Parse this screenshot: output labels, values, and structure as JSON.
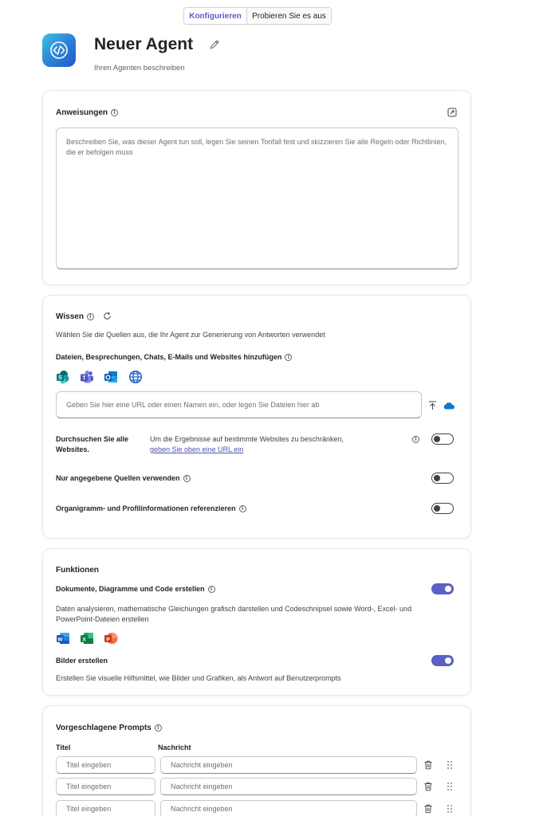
{
  "tabs": {
    "configure": "Konfigurieren",
    "try": "Probieren Sie es aus"
  },
  "agent": {
    "name": "Neuer Agent",
    "description": "Ihren Agenten beschreiben"
  },
  "instructions": {
    "title": "Anweisungen",
    "placeholder": "Beschreiben Sie, was dieser Agent tun soll, legen Sie seinen Tonfall fest und skizzieren Sie alle Regeln oder Richtlinien, die er befolgen muss"
  },
  "knowledge": {
    "title": "Wissen",
    "subtitle": "Wählen Sie die Quellen aus, die Ihr Agent zur Generierung von Antworten verwendet",
    "add_label": "Dateien, Besprechungen, Chats, E-Mails und Websites hinzufügen",
    "url_placeholder": "Geben Sie hier eine URL oder einen Namen ein, oder legen Sie Dateien hier ab",
    "search_all_label": "Durchsuchen Sie alle Websites.",
    "search_all_desc": "Um die Ergebnisse auf bestimmte Websites zu beschränken,",
    "search_all_link": "geben Sie oben eine URL ein",
    "only_sources_label": "Nur angegebene Quellen verwenden",
    "org_label": "Organigramm- und Profilinformationen referenzieren",
    "toggles": {
      "search_all": false,
      "only_sources": false,
      "org": false
    }
  },
  "functions": {
    "title": "Funktionen",
    "docs_label": "Dokumente, Diagramme und Code erstellen",
    "docs_desc": "Daten analysieren, mathematische Gleichungen grafisch darstellen und Codeschnipsel sowie Word-, Excel- und PowerPoint-Dateien erstellen",
    "images_label": "Bilder erstellen",
    "images_desc": "Erstellen Sie visuelle Hilfsmittel, wie Bilder und Grafiken, als Antwort auf Benutzerprompts",
    "toggles": {
      "docs": true,
      "images": true
    }
  },
  "prompts": {
    "title": "Vorgeschlagene Prompts",
    "col_title": "Titel",
    "col_message": "Nachricht",
    "rows": [
      {
        "title_placeholder": "Titel eingeben",
        "message_placeholder": "Nachricht eingeben"
      },
      {
        "title_placeholder": "Titel eingeben",
        "message_placeholder": "Nachricht eingeben"
      },
      {
        "title_placeholder": "Titel eingeben",
        "message_placeholder": "Nachricht eingeben"
      }
    ]
  },
  "colors": {
    "accent": "#5b5fc7",
    "link": "#4f52b2"
  },
  "icons": {
    "sources": [
      "sharepoint-icon",
      "teams-icon",
      "outlook-icon",
      "globe-icon"
    ],
    "apps": [
      "word-icon",
      "excel-icon",
      "powerpoint-icon"
    ]
  }
}
